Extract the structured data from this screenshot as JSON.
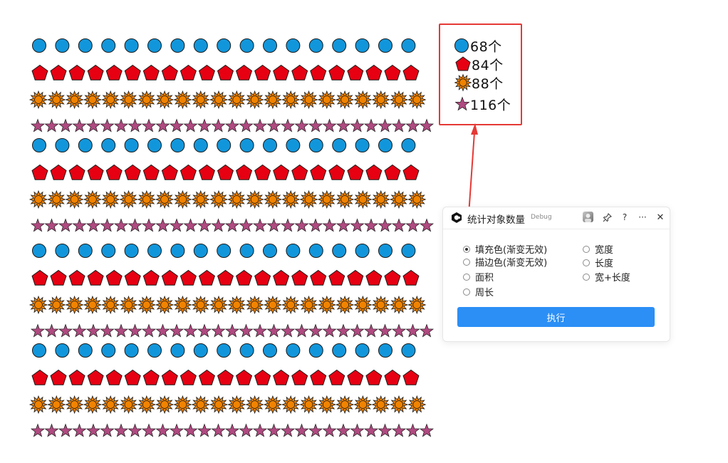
{
  "counts": [
    {
      "shape": "circle",
      "text": "68个",
      "color": "#1296db"
    },
    {
      "shape": "pentagon",
      "text": "84个",
      "color": "#e60012"
    },
    {
      "shape": "sun",
      "text": "88个",
      "color": "#f08300"
    },
    {
      "shape": "star",
      "text": "116个",
      "color": "#b04a80"
    }
  ],
  "canvas": {
    "row_pattern": [
      "circle",
      "pentagon",
      "sun",
      "star"
    ],
    "circles_per_row": 17,
    "pentagons_per_row": 21,
    "suns_per_row": 22,
    "stars_per_row": 29,
    "colors": {
      "circle": "#1296db",
      "pentagon": "#e60012",
      "sun": "#f08300",
      "star": "#b04a80",
      "outline": "#1a1a1a"
    }
  },
  "panel": {
    "title": "统计对象数量",
    "tag": "Debug",
    "header_icons": [
      "user-avatar",
      "pin-icon",
      "help-icon",
      "more-icon",
      "close-icon"
    ],
    "help_label": "?",
    "more_label": "···",
    "close_label": "✕",
    "options_left": [
      {
        "label": "填充色(渐变无效)",
        "checked": true
      },
      {
        "label": "描边色(渐变无效)",
        "checked": false
      },
      {
        "label": "面积",
        "checked": false
      },
      {
        "label": "周长",
        "checked": false
      }
    ],
    "options_right": [
      {
        "label": "宽度",
        "checked": false
      },
      {
        "label": "长度",
        "checked": false
      },
      {
        "label": "宽+长度",
        "checked": false
      }
    ],
    "execute_label": "执行",
    "accent": "#2b8ff6"
  },
  "annotation_color": "#e53935"
}
